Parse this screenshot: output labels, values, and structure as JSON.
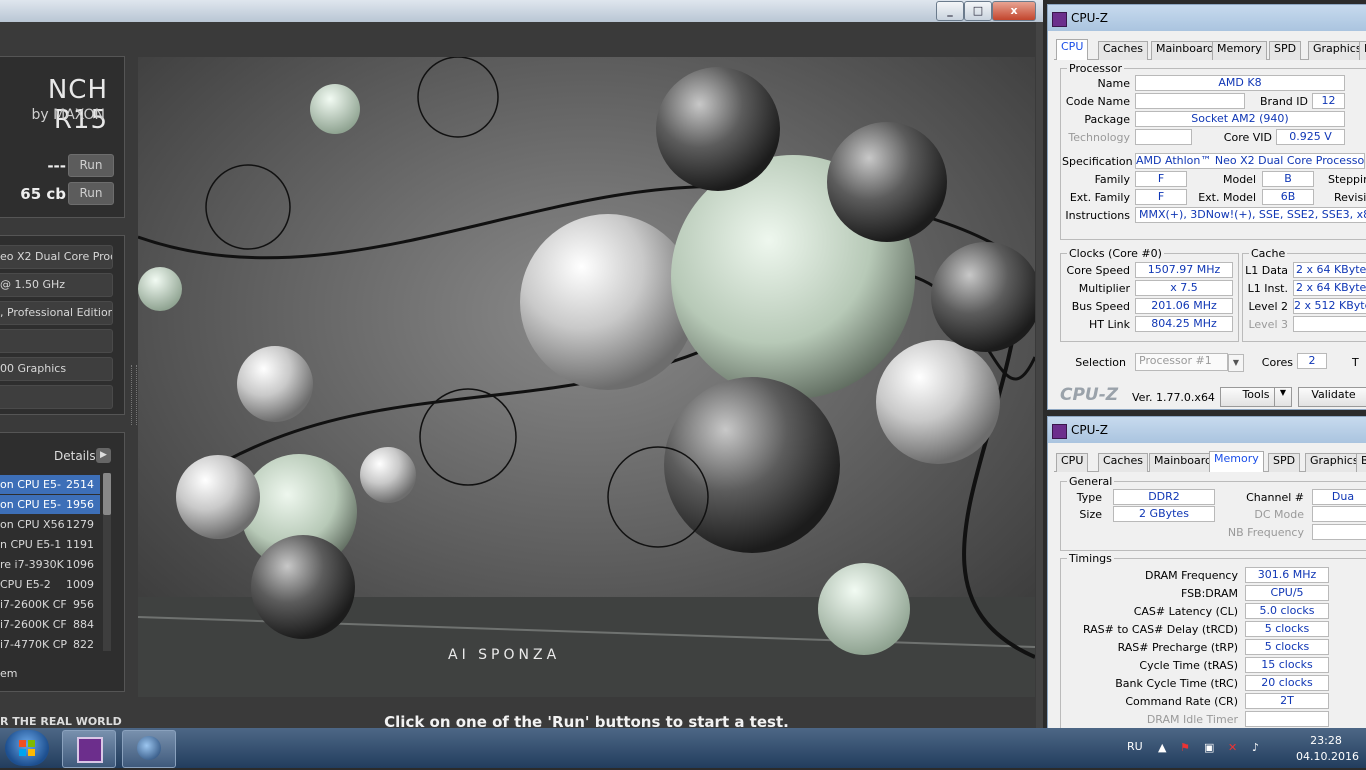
{
  "cinebench": {
    "window_buttons": {
      "minimize": "_",
      "maximize": "□",
      "close": "x"
    },
    "logo_title": "NCH R15",
    "logo_by": "by MAXON",
    "tests": [
      {
        "score": "---",
        "run": "Run"
      },
      {
        "score": "65 cb",
        "run": "Run"
      }
    ],
    "info_fields": [
      "eo X2 Dual Core Proc",
      "@ 1.50 GHz",
      ", Professional Editior",
      "",
      "00 Graphics",
      ""
    ],
    "details_label": "Details",
    "ranking": [
      {
        "name": "on CPU E5-",
        "score": "2514",
        "selected": true
      },
      {
        "name": "on CPU E5-",
        "score": "1956",
        "selected": true
      },
      {
        "name": "on CPU X56",
        "score": "1279",
        "selected": false
      },
      {
        "name": "n CPU E5-1",
        "score": "1191",
        "selected": false
      },
      {
        "name": "re i7-3930K",
        "score": "1096",
        "selected": false
      },
      {
        "name": "CPU E5-2",
        "score": "1009",
        "selected": false
      },
      {
        "name": "i7-2600K CF",
        "score": "956",
        "selected": false
      },
      {
        "name": "i7-2600K CF",
        "score": "884",
        "selected": false
      },
      {
        "name": "i7-4770K CP",
        "score": "822",
        "selected": false
      }
    ],
    "ranking_footer": "em",
    "tagline": "R THE REAL WORLD",
    "render_watermark": "AI SPONZA",
    "status": "Click on one of the 'Run' buttons to start a test."
  },
  "cpuz1": {
    "title": "CPU-Z",
    "tabs": [
      "CPU",
      "Caches",
      "Mainboard",
      "Memory",
      "SPD",
      "Graphics",
      "Be"
    ],
    "active_tab": "CPU",
    "processor_group": "Processor",
    "name_label": "Name",
    "name": "AMD K8",
    "codename_label": "Code Name",
    "brandid_label": "Brand ID",
    "brandid": "12",
    "package_label": "Package",
    "package": "Socket AM2 (940)",
    "technology_label": "Technology",
    "corevid_label": "Core VID",
    "corevid": "0.925 V",
    "spec_label": "Specification",
    "spec": "AMD Athlon™ Neo X2 Dual Core Processor",
    "family_label": "Family",
    "family": "F",
    "model_label": "Model",
    "model": "B",
    "stepping_label": "Steppin",
    "extfamily_label": "Ext. Family",
    "extfamily": "F",
    "extmodel_label": "Ext. Model",
    "extmodel": "6B",
    "revision_label": "Revisio",
    "instr_label": "Instructions",
    "instr": "MMX(+), 3DNow!(+), SSE, SSE2, SSE3, x86-64",
    "clocks_group": "Clocks (Core #0)",
    "corespeed_label": "Core Speed",
    "corespeed": "1507.97 MHz",
    "mult_label": "Multiplier",
    "mult": "x 7.5",
    "bus_label": "Bus Speed",
    "bus": "201.06 MHz",
    "ht_label": "HT Link",
    "ht": "804.25 MHz",
    "cache_group": "Cache",
    "l1d_label": "L1 Data",
    "l1d": "2 x 64 KBytes",
    "l1i_label": "L1 Inst.",
    "l1i": "2 x 64 KBytes",
    "l2_label": "Level 2",
    "l2": "2 x 512 KBytes",
    "l3_label": "Level 3",
    "selection_label": "Selection",
    "selection": "Processor #1",
    "cores_label": "Cores",
    "cores": "2",
    "threads_label": "T",
    "brand": "CPU-Z",
    "version": "Ver. 1.77.0.x64",
    "tools": "Tools",
    "validate": "Validate"
  },
  "cpuz2": {
    "title": "CPU-Z",
    "tabs": [
      "CPU",
      "Caches",
      "Mainboard",
      "Memory",
      "SPD",
      "Graphics",
      "Be"
    ],
    "active_tab": "Memory",
    "general_group": "General",
    "type_label": "Type",
    "type": "DDR2",
    "channel_label": "Channel #",
    "channel": "Dua",
    "size_label": "Size",
    "size": "2 GBytes",
    "dcmode_label": "DC Mode",
    "nbfreq_label": "NB Frequency",
    "timings_group": "Timings",
    "timings": [
      {
        "label": "DRAM Frequency",
        "value": "301.6 MHz",
        "disabled": false
      },
      {
        "label": "FSB:DRAM",
        "value": "CPU/5",
        "disabled": false
      },
      {
        "label": "CAS# Latency (CL)",
        "value": "5.0 clocks",
        "disabled": false
      },
      {
        "label": "RAS# to CAS# Delay (tRCD)",
        "value": "5 clocks",
        "disabled": false
      },
      {
        "label": "RAS# Precharge (tRP)",
        "value": "5 clocks",
        "disabled": false
      },
      {
        "label": "Cycle Time (tRAS)",
        "value": "15 clocks",
        "disabled": false
      },
      {
        "label": "Bank Cycle Time (tRC)",
        "value": "20 clocks",
        "disabled": false
      },
      {
        "label": "Command Rate (CR)",
        "value": "2T",
        "disabled": false
      },
      {
        "label": "DRAM Idle Timer",
        "value": "",
        "disabled": true
      }
    ]
  },
  "taskbar": {
    "lang": "RU",
    "time": "23:28",
    "date": "04.10.2016"
  }
}
